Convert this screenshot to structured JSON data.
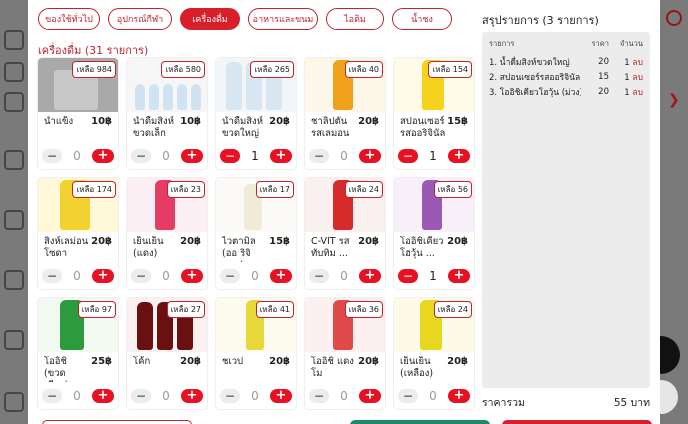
{
  "categories": [
    {
      "label": "ของใช้ทั่วไป",
      "active": false
    },
    {
      "label": "อุปกรณ์กีฬา",
      "active": false
    },
    {
      "label": "เครื่องดื่ม",
      "active": true
    },
    {
      "label": "อาหารและขนม",
      "active": false
    },
    {
      "label": "ไอติม",
      "active": false
    },
    {
      "label": "น้ำชง",
      "active": false
    }
  ],
  "section_title": "เครื่องดื่ม (31 รายการ)",
  "products": [
    {
      "name": "น้ำแข็ง",
      "price": "10฿",
      "stock": "เหลือ 984",
      "qty": "0"
    },
    {
      "name": "น้ำดื่มสิงห์ ขวดเล็ก",
      "price": "10฿",
      "stock": "เหลือ 580",
      "qty": "0"
    },
    {
      "name": "น้ำดื่มสิงห์ ขวดใหญ่",
      "price": "20฿",
      "stock": "เหลือ 265",
      "qty": "1"
    },
    {
      "name": "ชาลิปตัน รสเลมอน",
      "price": "20฿",
      "stock": "เหลือ 40",
      "qty": "0"
    },
    {
      "name": "สปอนเซอร์ รสออริจินัล",
      "price": "15฿",
      "stock": "เหลือ 154",
      "qty": "1"
    },
    {
      "name": "สิงห์เลม่อน โซดา",
      "price": "20฿",
      "stock": "เหลือ 174",
      "qty": "0"
    },
    {
      "name": "เย็นเย็น (แดง)",
      "price": "20฿",
      "stock": "เหลือ 23",
      "qty": "0"
    },
    {
      "name": "ไวตามิล (ออ ริจินอล)",
      "price": "15฿",
      "stock": "เหลือ 17",
      "qty": "0"
    },
    {
      "name": "C-VIT รส ทับทิม ...",
      "price": "20฿",
      "stock": "เหลือ 24",
      "qty": "0"
    },
    {
      "name": "โออิชิเคียว โฮวุ้น ...",
      "price": "20฿",
      "stock": "เหลือ 56",
      "qty": "1"
    },
    {
      "name": "โออิชิ (ขวด เขียว)",
      "price": "25฿",
      "stock": "เหลือ 97",
      "qty": "0"
    },
    {
      "name": "โค้ก",
      "price": "20฿",
      "stock": "เหลือ 27",
      "qty": "0"
    },
    {
      "name": "ชเวป",
      "price": "20฿",
      "stock": "เหลือ 41",
      "qty": "0"
    },
    {
      "name": "โออิชิ แดงโม",
      "price": "20฿",
      "stock": "เหลือ 36",
      "qty": "0"
    },
    {
      "name": "เย็นเย็น (เหลือง)",
      "price": "20฿",
      "stock": "เหลือ 24",
      "qty": "0"
    }
  ],
  "summary": {
    "title": "สรุปรายการ (3 รายการ)",
    "header": {
      "item": "รายการ",
      "price": "ราคา",
      "qty": "จำนวน"
    },
    "rows": [
      {
        "item": "1. น้ำดื่มสิงห์ขวดใหญ่",
        "price": "20",
        "qty": "1",
        "unit": "ลบ"
      },
      {
        "item": "2. สปอนเซอร์รสออริจินัล",
        "price": "15",
        "qty": "1",
        "unit": "ลบ"
      },
      {
        "item": "3. โออิชิเคียวโฮวุ้น (ม่วง)",
        "price": "20",
        "qty": "1",
        "unit": "ลบ"
      }
    ],
    "total_label": "ราคารวม",
    "total_value": "55 บาท"
  },
  "colors": {
    "accent": "#e81123",
    "brand_text": "#c0232e",
    "summary_bg": "#ececec"
  }
}
